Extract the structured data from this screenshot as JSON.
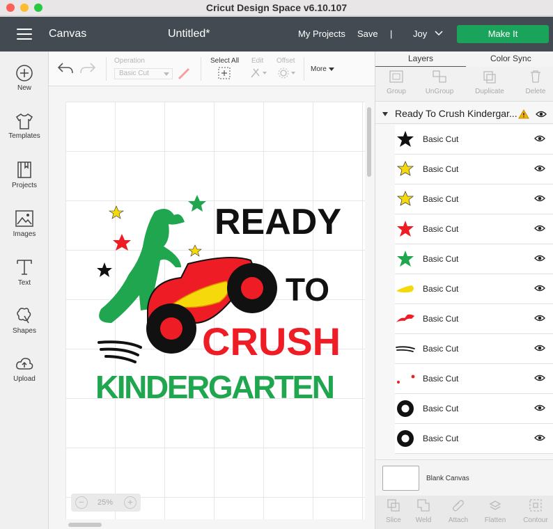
{
  "window": {
    "title": "Cricut Design Space  v6.10.107"
  },
  "header": {
    "section": "Canvas",
    "doc_title": "Untitled*",
    "my_projects": "My Projects",
    "save": "Save",
    "separator": "|",
    "user": "Joy",
    "make_it": "Make It",
    "make_it_color": "#1aa35a"
  },
  "leftnav": {
    "items": [
      {
        "label": "New",
        "icon": "plus-circle-icon"
      },
      {
        "label": "Templates",
        "icon": "tshirt-icon"
      },
      {
        "label": "Projects",
        "icon": "book-icon"
      },
      {
        "label": "Images",
        "icon": "image-icon"
      },
      {
        "label": "Text",
        "icon": "text-T-icon"
      },
      {
        "label": "Shapes",
        "icon": "shapes-icon"
      },
      {
        "label": "Upload",
        "icon": "cloud-upload-icon"
      }
    ]
  },
  "toolbar": {
    "operation_label": "Operation",
    "operation_value": "Basic Cut",
    "select_all": "Select All",
    "edit": "Edit",
    "offset": "Offset",
    "more": "More"
  },
  "canvas": {
    "zoom": "25%",
    "zoom_out": "−",
    "zoom_in": "+",
    "design": {
      "line1": "READY",
      "line2": "TO",
      "line3": "CRUSH",
      "line4": "KINDERGARTEN",
      "colors": {
        "black": "#111111",
        "red": "#ee1c25",
        "green": "#1fa64f",
        "yellow": "#f5d90a"
      }
    }
  },
  "rightpanel": {
    "tabs": [
      "Layers",
      "Color Sync"
    ],
    "tools": [
      "Group",
      "UnGroup",
      "Duplicate",
      "Delete"
    ],
    "group_title": "Ready To Crush Kindergar...",
    "layers": [
      {
        "name": "Basic Cut",
        "thumb": "black-star"
      },
      {
        "name": "Basic Cut",
        "thumb": "yellow-star"
      },
      {
        "name": "Basic Cut",
        "thumb": "yellow-star"
      },
      {
        "name": "Basic Cut",
        "thumb": "red-star"
      },
      {
        "name": "Basic Cut",
        "thumb": "green-star"
      },
      {
        "name": "Basic Cut",
        "thumb": "yellow-flame"
      },
      {
        "name": "Basic Cut",
        "thumb": "red-piece"
      },
      {
        "name": "Basic Cut",
        "thumb": "black-speedlines"
      },
      {
        "name": "Basic Cut",
        "thumb": "red-dots"
      },
      {
        "name": "Basic Cut",
        "thumb": "black-tire"
      },
      {
        "name": "Basic Cut",
        "thumb": "black-tire"
      }
    ],
    "blank_canvas": "Blank Canvas",
    "bottom_tools": [
      "Slice",
      "Weld",
      "Attach",
      "Flatten",
      "Contour"
    ]
  }
}
